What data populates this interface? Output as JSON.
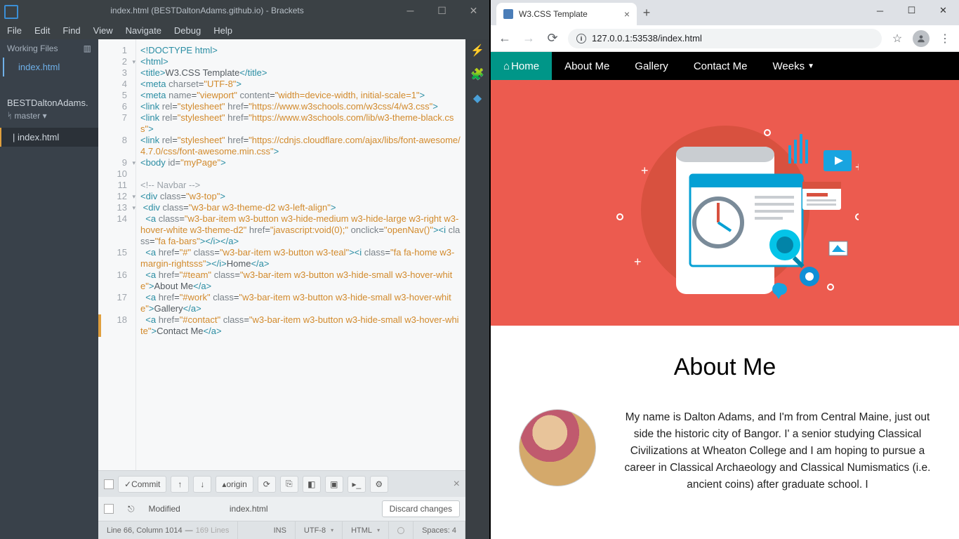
{
  "editor": {
    "title": "index.html (BESTDaltonAdams.github.io) - Brackets",
    "menu": [
      "File",
      "Edit",
      "Find",
      "View",
      "Navigate",
      "Debug",
      "Help"
    ],
    "working_files_label": "Working Files",
    "working_file": "index.html",
    "project_name": "BESTDaltonAdams.",
    "branch": "master",
    "project_file": "index.html",
    "git": {
      "commit": "Commit",
      "origin": "origin",
      "modified": "Modified",
      "file": "index.html",
      "discard": "Discard changes"
    },
    "status": {
      "linecol": "Line 66, Column 1014",
      "total": "169 Lines",
      "ins": "INS",
      "enc": "UTF-8",
      "lang": "HTML",
      "spaces": "Spaces: 4"
    }
  },
  "code": [
    {
      "n": 1,
      "h": "<span class='t-tag'>&lt;!DOCTYPE html&gt;</span>"
    },
    {
      "n": 2,
      "fold": true,
      "h": "<span class='t-tag'>&lt;html&gt;</span>"
    },
    {
      "n": 3,
      "h": "<span class='t-tag'>&lt;title&gt;</span>W3.CSS Template<span class='t-tag'>&lt;/title&gt;</span>"
    },
    {
      "n": 4,
      "h": "<span class='t-tag'>&lt;meta</span> <span class='t-attr'>charset</span>=<span class='t-str'>\"UTF-8\"</span><span class='t-tag'>&gt;</span>"
    },
    {
      "n": 5,
      "h": "<span class='t-tag'>&lt;meta</span> <span class='t-attr'>name</span>=<span class='t-str'>\"viewport\"</span> <span class='t-attr'>content</span>=<span class='t-str'>\"width=device-width, initial-scale=1\"</span><span class='t-tag'>&gt;</span>"
    },
    {
      "n": 6,
      "h": "<span class='t-tag'>&lt;link</span> <span class='t-attr'>rel</span>=<span class='t-str'>\"stylesheet\"</span> <span class='t-attr'>href</span>=<span class='t-str'>\"https://www.w3schools.com/w3css/4/w3.css\"</span><span class='t-tag'>&gt;</span>"
    },
    {
      "n": 7,
      "h": "<span class='t-tag'>&lt;link</span> <span class='t-attr'>rel</span>=<span class='t-str'>\"stylesheet\"</span> <span class='t-attr'>href</span>=<span class='t-str'>\"https://www.w3schools.com/lib/w3-theme-black.css\"</span><span class='t-tag'>&gt;</span>"
    },
    {
      "n": 8,
      "h": "<span class='t-tag'>&lt;link</span> <span class='t-attr'>rel</span>=<span class='t-str'>\"stylesheet\"</span> <span class='t-attr'>href</span>=<span class='t-str'>\"https://cdnjs.cloudflare.com/ajax/libs/font-awesome/4.7.0/css/font-awesome.min.css\"</span><span class='t-tag'>&gt;</span>"
    },
    {
      "n": 9,
      "fold": true,
      "h": "<span class='t-tag'>&lt;body</span> <span class='t-attr'>id</span>=<span class='t-str'>\"myPage\"</span><span class='t-tag'>&gt;</span>"
    },
    {
      "n": 10,
      "h": ""
    },
    {
      "n": 11,
      "h": "<span class='t-cmt'>&lt;!-- Navbar --&gt;</span>"
    },
    {
      "n": 12,
      "fold": true,
      "h": "<span class='t-tag'>&lt;div</span> <span class='t-attr'>class</span>=<span class='t-str'>\"w3-top\"</span><span class='t-tag'>&gt;</span>"
    },
    {
      "n": 13,
      "fold": true,
      "h": "&nbsp;<span class='t-tag'>&lt;div</span> <span class='t-attr'>class</span>=<span class='t-str'>\"w3-bar w3-theme-d2 w3-left-align\"</span><span class='t-tag'>&gt;</span>"
    },
    {
      "n": 14,
      "h": "&nbsp;&nbsp;<span class='t-tag'>&lt;a</span> <span class='t-attr'>class</span>=<span class='t-str'>\"w3-bar-item w3-button w3-hide-medium w3-hide-large w3-right w3-hover-white w3-theme-d2\"</span> <span class='t-attr'>href</span>=<span class='t-str'>\"javascript:void(0);\"</span> <span class='t-attr'>onclick</span>=<span class='t-str'>\"openNav()\"</span><span class='t-tag'>&gt;&lt;i</span> <span class='t-attr'>class</span>=<span class='t-str'>\"fa fa-bars\"</span><span class='t-tag'>&gt;&lt;/i&gt;&lt;/a&gt;</span>"
    },
    {
      "n": 15,
      "h": "&nbsp;&nbsp;<span class='t-tag'>&lt;a</span> <span class='t-attr'>href</span>=<span class='t-str'>\"#\"</span> <span class='t-attr'>class</span>=<span class='t-str'>\"w3-bar-item w3-button w3-teal\"</span><span class='t-tag'>&gt;&lt;i</span> <span class='t-attr'>class</span>=<span class='t-str'>\"fa fa-home w3-margin-rightsss\"</span><span class='t-tag'>&gt;&lt;/i&gt;</span>Home<span class='t-tag'>&lt;/a&gt;</span>"
    },
    {
      "n": 16,
      "h": "&nbsp;&nbsp;<span class='t-tag'>&lt;a</span> <span class='t-attr'>href</span>=<span class='t-str'>\"#team\"</span> <span class='t-attr'>class</span>=<span class='t-str'>\"w3-bar-item w3-button w3-hide-small w3-hover-white\"</span><span class='t-tag'>&gt;</span>About Me<span class='t-tag'>&lt;/a&gt;</span>"
    },
    {
      "n": 17,
      "h": "&nbsp;&nbsp;<span class='t-tag'>&lt;a</span> <span class='t-attr'>href</span>=<span class='t-str'>\"#work\"</span> <span class='t-attr'>class</span>=<span class='t-str'>\"w3-bar-item w3-button w3-hide-small w3-hover-white\"</span><span class='t-tag'>&gt;</span>Gallery<span class='t-tag'>&lt;/a&gt;</span>"
    },
    {
      "n": 18,
      "mark": true,
      "h": "&nbsp;&nbsp;<span class='t-tag'>&lt;a</span> <span class='t-attr'>href</span>=<span class='t-str'>\"#contact\"</span> <span class='t-attr'>class</span>=<span class='t-str'>\"w3-bar-item w3-button w3-hide-small w3-hover-white\"</span><span class='t-tag'>&gt;</span>Contact Me<span class='t-tag'>&lt;/a&gt;</span>"
    }
  ],
  "browser": {
    "tab_title": "W3.CSS Template",
    "url": "127.0.0.1:53538/index.html",
    "nav": {
      "home": "Home",
      "about": "About Me",
      "gallery": "Gallery",
      "contact": "Contact Me",
      "weeks": "Weeks"
    },
    "about_heading": "About Me",
    "about_text": "My name is Dalton Adams, and I'm from Central Maine, just out side the historic city of Bangor. I' a senior studying Classical Civilizations at Wheaton College and I am hoping to pursue a career in Classical Archaeology and Classical Numismatics (i.e. ancient coins) after graduate school. I"
  }
}
